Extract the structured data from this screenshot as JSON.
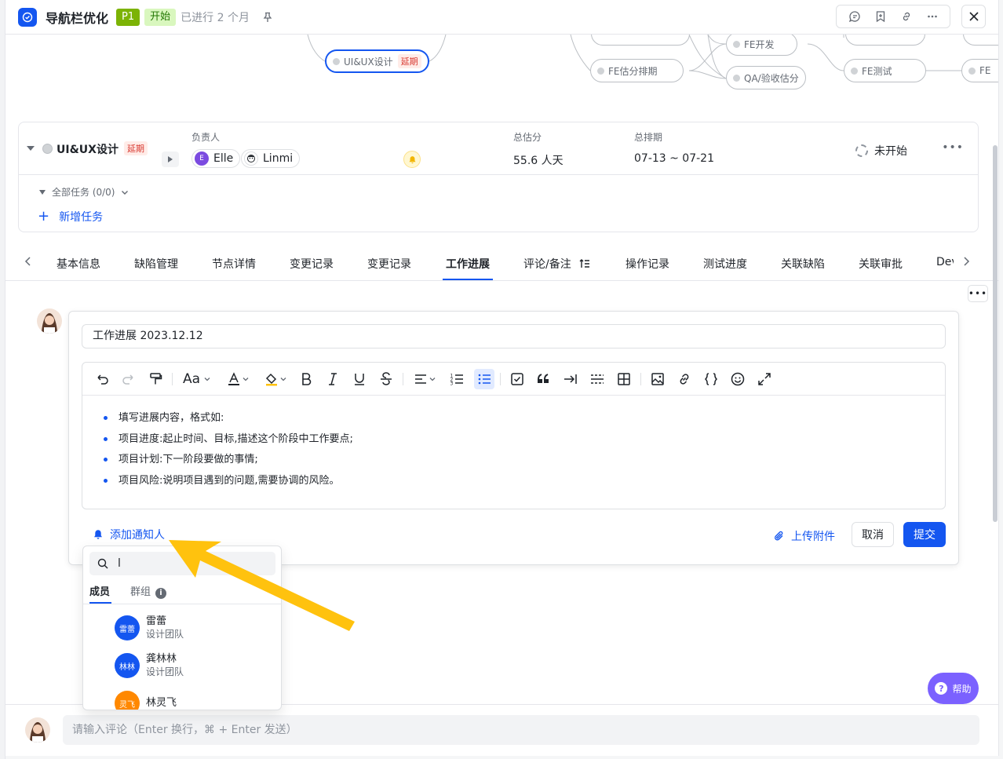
{
  "header": {
    "title": "导航栏优化",
    "priority": "P1",
    "status_tag": "开始",
    "elapsed": "已进行 2 个月"
  },
  "graph": {
    "nodes": [
      {
        "label": "UI&UX设计",
        "late": "延期"
      },
      {
        "label": "FE开发"
      },
      {
        "label": "FE估分排期"
      },
      {
        "label": "QA/验收估分"
      },
      {
        "label": "FE测试"
      },
      {
        "label": "FE"
      }
    ]
  },
  "stage": {
    "name": "UI&UX设计",
    "late_tag": "延期",
    "owner_label": "负责人",
    "owners": [
      {
        "name": "Elle",
        "initial": "E"
      },
      {
        "name": "Linmi"
      }
    ],
    "estimate_label": "总估分",
    "estimate_value": "55.6 人天",
    "schedule_label": "总排期",
    "schedule_value": "07-13 ~ 07-21",
    "status": "未开始",
    "all_tasks": "全部任务 (0/0)",
    "add_task": "新增任务"
  },
  "tabs": [
    {
      "label": "基本信息"
    },
    {
      "label": "缺陷管理"
    },
    {
      "label": "节点详情"
    },
    {
      "label": "变更记录"
    },
    {
      "label": "变更记录"
    },
    {
      "label": "工作进展",
      "active": true
    },
    {
      "label": "评论/备注"
    },
    {
      "label": "操作记录"
    },
    {
      "label": "测试进度"
    },
    {
      "label": "关联缺陷"
    },
    {
      "label": "关联审批"
    },
    {
      "label": "Dev"
    }
  ],
  "editor": {
    "title_value": "工作进展 2023.12.12",
    "font_button": "Aa",
    "bullets": [
      "填写进展内容，格式如:",
      "项目进度:起止时间、目标,描述这个阶段中工作要点;",
      "项目计划:下一阶段要做的事情;",
      "项目风险:说明项目遇到的问题,需要协调的风险。"
    ],
    "notify_label": "添加通知人",
    "upload_label": "上传附件",
    "cancel_label": "取消",
    "submit_label": "提交"
  },
  "dropdown": {
    "search_value": "l",
    "tab_members": "成员",
    "tab_groups": "群组",
    "members": [
      {
        "name": "雷蕾",
        "team": "设计团队",
        "avatar_text": "雷蕾",
        "color": "#1456f0"
      },
      {
        "name": "龚林林",
        "team": "设计团队",
        "avatar_text": "林林",
        "color": "#1456f0"
      },
      {
        "name": "林灵飞",
        "team": "",
        "avatar_text": "灵飞",
        "color": "#ff8800"
      }
    ]
  },
  "comment": {
    "placeholder": "请输入评论（Enter 换行，⌘ + Enter 发送）"
  },
  "help": {
    "label": "帮助"
  },
  "colors": {
    "accent": "#1456f0",
    "late_bg": "#ffece8",
    "late_text": "#d83931",
    "arrow": "#ffc20e",
    "help_bg": "#7b61ff"
  }
}
